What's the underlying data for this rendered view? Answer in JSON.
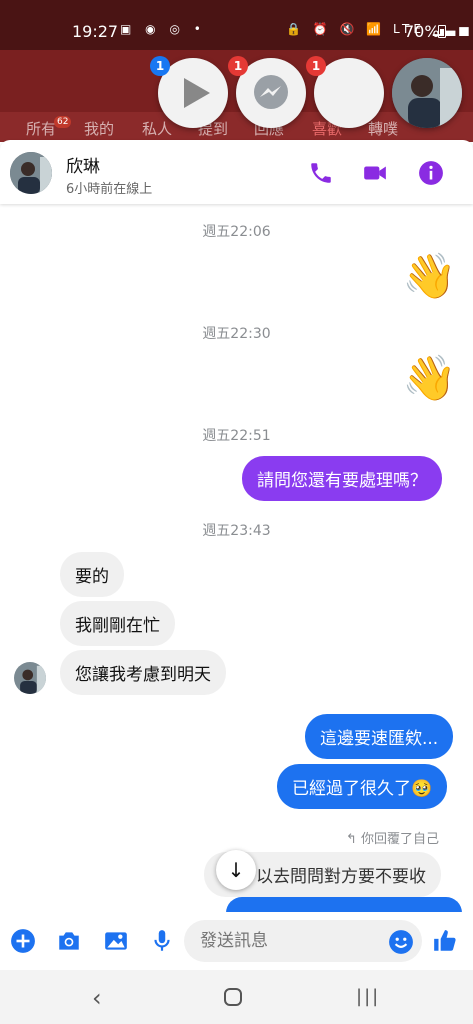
{
  "status_bar": {
    "time": "19:27",
    "left_icons": "▣ ◉ ◎ •",
    "right_icons": "🔒 ⏰ 🔇 📶 LTE ▁▃▅",
    "battery": "70%"
  },
  "background_app": {
    "tabs": [
      "所有",
      "我的",
      "私人",
      "提到",
      "回應",
      "喜歡",
      "轉噗"
    ],
    "badge": "62"
  },
  "chat_heads": [
    {
      "name": "video-player",
      "badge": "1",
      "badge_color": "#1877f2"
    },
    {
      "name": "messenger",
      "badge": "1",
      "badge_color": "#e53935"
    },
    {
      "name": "blank-app",
      "badge": "1",
      "badge_color": "#e53935"
    },
    {
      "name": "contact-avatar"
    }
  ],
  "chat_header": {
    "name": "欣琳",
    "presence": "6小時前在線上",
    "accent_color": "#8a2be2"
  },
  "messages": {
    "ts1": "週五22:06",
    "ts2": "週五22:30",
    "ts3": "週五22:51",
    "ts4": "週五23:43",
    "out1": "請問您還有要處理嗎？",
    "in1": "要的",
    "in2": "我剛剛在忙",
    "in3": "您讓我考慮到明天",
    "out2": "這邊要速匯欸...",
    "out3": "已經過了很久了🥹",
    "reply_note": "↰ 你回覆了自己",
    "quoted": "以去問問對方要不要收"
  },
  "composer": {
    "placeholder": "發送訊息"
  }
}
